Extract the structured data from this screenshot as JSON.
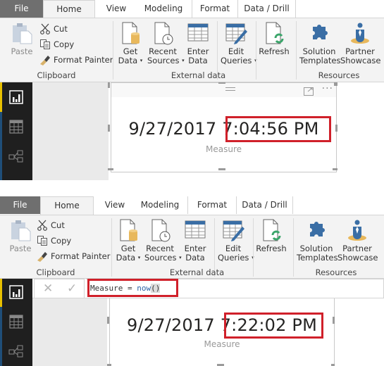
{
  "tabs": [
    "File",
    "Home",
    "View",
    "Modeling",
    "Format",
    "Data / Drill"
  ],
  "ribbon": {
    "clipboard": {
      "paste": "Paste",
      "cut": "Cut",
      "copy": "Copy",
      "format_painter": "Format Painter",
      "label": "Clipboard"
    },
    "external_data": {
      "get_data": [
        "Get",
        "Data"
      ],
      "recent_sources": [
        "Recent",
        "Sources"
      ],
      "enter_data": [
        "Enter",
        "Data"
      ],
      "edit_queries": [
        "Edit",
        "Queries"
      ],
      "refresh": "Refresh",
      "label": "External data"
    },
    "resources": {
      "solution_templates": [
        "Solution",
        "Templates"
      ],
      "partner_showcase": [
        "Partner",
        "Showcase"
      ],
      "label": "Resources"
    },
    "dropdown_caret": "▾"
  },
  "icons": {
    "cut": "scissors-icon",
    "copy": "copy-icon",
    "format_painter": "brush-icon",
    "paste": "clipboard-icon",
    "get_data": "database-file-icon",
    "recent_sources": "clock-file-icon",
    "enter_data": "table-icon",
    "edit_queries": "table-edit-icon",
    "refresh": "refresh-file-icon",
    "solution_templates": "puzzle-icon",
    "partner_showcase": "person-icon",
    "report_view": "bar-chart-icon",
    "data_view": "grid-icon",
    "relationships_view": "relationships-icon",
    "focus_mode": "expand-icon",
    "more_options": "ellipsis-icon"
  },
  "colors": {
    "highlight": "#d0202a",
    "nav_active": "#e8c000",
    "file_tab": "#6f6f6f",
    "dax_function": "#2b63a6"
  },
  "screenshot1": {
    "card": {
      "date": "9/27/2017",
      "time": "7:04:56 PM",
      "category": "Measure",
      "more": "···"
    }
  },
  "screenshot2": {
    "formula": {
      "prefix": "Measure = ",
      "function": "now",
      "parens": "()",
      "cancel": "✕",
      "commit": "✓"
    },
    "card": {
      "date": "9/27/2017",
      "time": "7:22:02 PM",
      "category": "Measure"
    }
  }
}
